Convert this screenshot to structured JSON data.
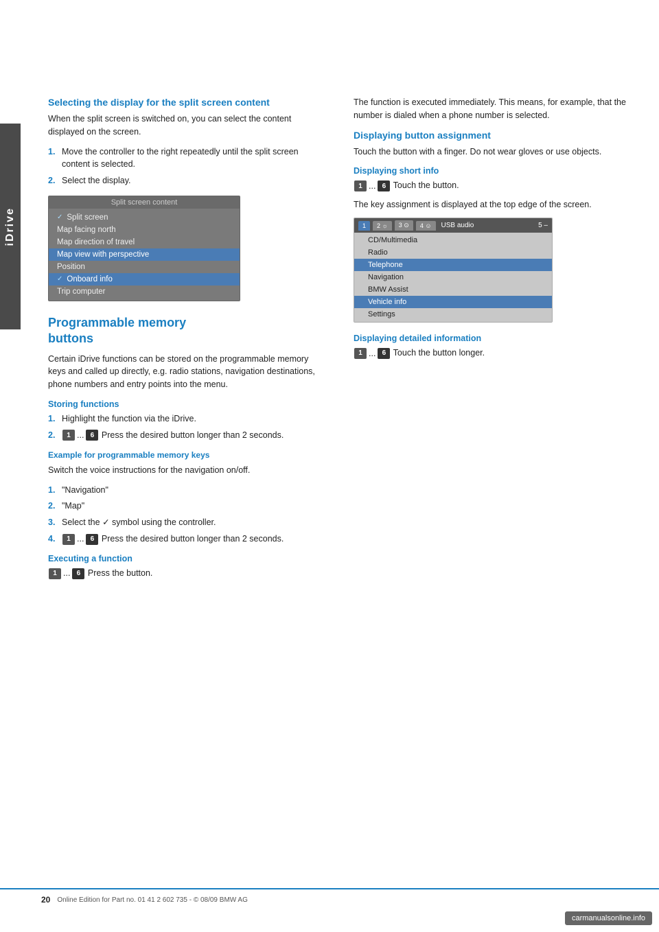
{
  "sidebar": {
    "label": "iDrive"
  },
  "left_column": {
    "section1": {
      "title": "Selecting the display for the split screen content",
      "body": "When the split screen is switched on, you can select the content displayed on the screen.",
      "steps": [
        "Move the controller to the right repeatedly until the split screen content is selected.",
        "Select the display."
      ],
      "screen_mockup": {
        "title": "Split screen content",
        "items": [
          {
            "label": "✓ Split screen",
            "checked": true,
            "highlighted": false
          },
          {
            "label": "Map facing north",
            "checked": false,
            "highlighted": false
          },
          {
            "label": "Map direction of travel",
            "checked": false,
            "highlighted": false
          },
          {
            "label": "Map view with perspective",
            "checked": false,
            "highlighted": true
          },
          {
            "label": "Position",
            "checked": false,
            "highlighted": false
          },
          {
            "label": "✓ Onboard info",
            "checked": true,
            "highlighted": true
          },
          {
            "label": "Trip computer",
            "checked": false,
            "highlighted": false
          }
        ]
      }
    },
    "section2": {
      "title": "Programmable memory buttons",
      "body": "Certain iDrive functions can be stored on the programmable memory keys and called up directly, e.g. radio stations, navigation destinations, phone numbers and entry points into the menu.",
      "storing": {
        "title": "Storing functions",
        "steps": [
          "Highlight the function via the iDrive.",
          "Press the desired button longer than 2 seconds."
        ],
        "step2_prefix": "1 ... 6"
      },
      "example": {
        "title": "Example for programmable memory keys",
        "body": "Switch the voice instructions for the navigation on/off.",
        "steps": [
          "\"Navigation\"",
          "\"Map\"",
          "Select the ✓ symbol using the controller.",
          "Press the desired button longer than 2 seconds."
        ],
        "step4_prefix": "1 ... 6"
      },
      "executing": {
        "title": "Executing a function",
        "body": "Press the button.",
        "prefix": "1 ... 6"
      }
    }
  },
  "right_column": {
    "intro_text": "The function is executed immediately. This means, for example, that the number is dialed when a phone number is selected.",
    "section1": {
      "title": "Displaying button assignment",
      "body": "Touch the button with a finger. Do not wear gloves or use objects.",
      "sub1": {
        "title": "Displaying short info",
        "instruction": "Touch the button.",
        "key_prefix": "1 ... 6",
        "detail": "The key assignment is displayed at the top edge of the screen."
      },
      "usb_screen": {
        "tabs": [
          "1",
          "2 ☼",
          "3 ⊙",
          "4 ☺"
        ],
        "title": "USB audio",
        "page_num": "5",
        "items": [
          {
            "label": "CD/Multimedia",
            "highlighted": false
          },
          {
            "label": "Radio",
            "highlighted": false
          },
          {
            "label": "Telephone",
            "highlighted": true
          },
          {
            "label": "Navigation",
            "highlighted": false
          },
          {
            "label": "BMW Assist",
            "highlighted": false
          },
          {
            "label": "Vehicle info",
            "highlighted": true
          },
          {
            "label": "Settings",
            "highlighted": false
          }
        ]
      },
      "sub2": {
        "title": "Displaying detailed information",
        "instruction": "Touch the button longer.",
        "key_prefix": "1 ... 6"
      }
    }
  },
  "footer": {
    "page_number": "20",
    "footer_text": "Online Edition for Part no. 01 41 2 602 735 - © 08/09 BMW AG"
  },
  "watermark": "carmanualsonline.info"
}
